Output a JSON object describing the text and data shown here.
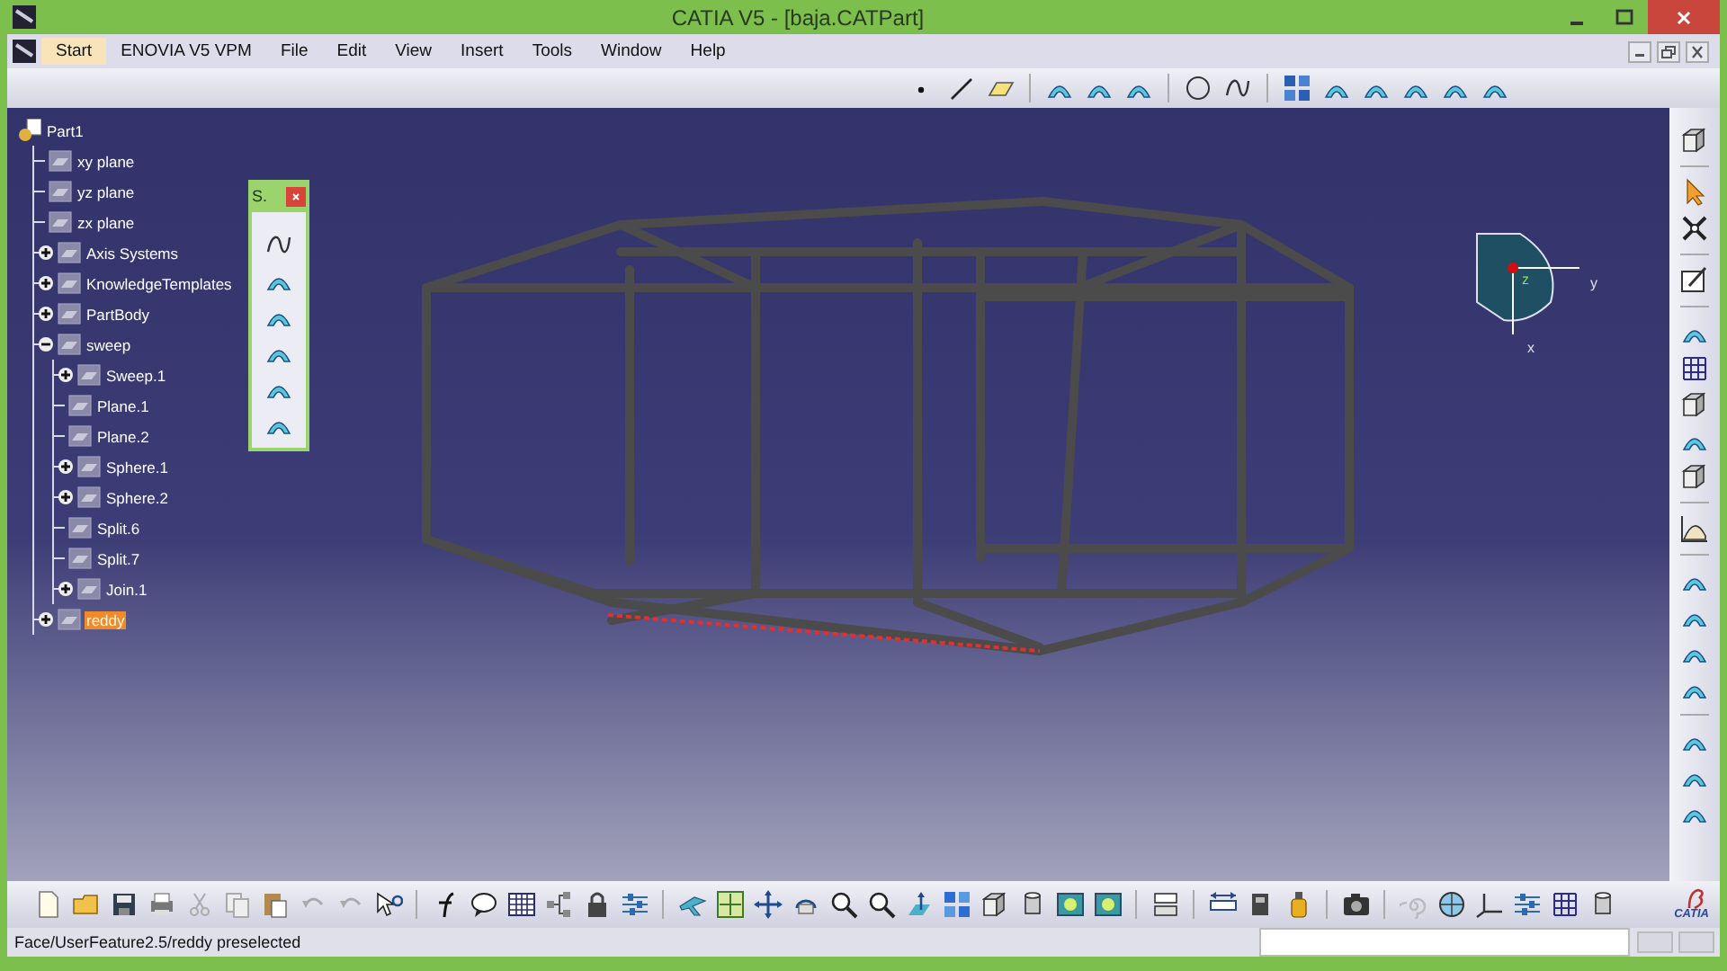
{
  "window": {
    "title": "CATIA V5 - [baja.CATPart]"
  },
  "menu": [
    {
      "label": "Start",
      "selected": true
    },
    {
      "label": "ENOVIA V5 VPM",
      "selected": false
    },
    {
      "label": "File",
      "selected": false
    },
    {
      "label": "Edit",
      "selected": false
    },
    {
      "label": "View",
      "selected": false
    },
    {
      "label": "Insert",
      "selected": false
    },
    {
      "label": "Tools",
      "selected": false
    },
    {
      "label": "Window",
      "selected": false
    },
    {
      "label": "Help",
      "selected": false
    }
  ],
  "tree": {
    "label": "Part1",
    "selected": false,
    "children": [
      {
        "label": "xy plane",
        "selected": false
      },
      {
        "label": "yz plane",
        "selected": false
      },
      {
        "label": "zx plane",
        "selected": false
      },
      {
        "label": "Axis Systems",
        "selected": false,
        "expanded": false
      },
      {
        "label": "KnowledgeTemplates",
        "selected": false,
        "expanded": false
      },
      {
        "label": "PartBody",
        "selected": false,
        "expanded": false
      },
      {
        "label": "sweep",
        "selected": false,
        "expanded": true,
        "children": [
          {
            "label": "Sweep.1",
            "selected": false,
            "expanded": false
          },
          {
            "label": "Plane.1",
            "selected": false
          },
          {
            "label": "Plane.2",
            "selected": false
          },
          {
            "label": "Sphere.1",
            "selected": false,
            "expanded": false
          },
          {
            "label": "Sphere.2",
            "selected": false,
            "expanded": false
          },
          {
            "label": "Split.6",
            "selected": false
          },
          {
            "label": "Split.7",
            "selected": false
          },
          {
            "label": "Join.1",
            "selected": false,
            "expanded": false
          }
        ]
      },
      {
        "label": "reddy",
        "selected": true,
        "expanded": false
      }
    ]
  },
  "floating_toolbar": {
    "title": "S."
  },
  "compass": {
    "z_label": "z",
    "y_label": "y",
    "x_label": "x"
  },
  "status_bar": {
    "message": "Face/UserFeature2.5/reddy preselected"
  },
  "logo": {
    "text": "CATIA"
  }
}
